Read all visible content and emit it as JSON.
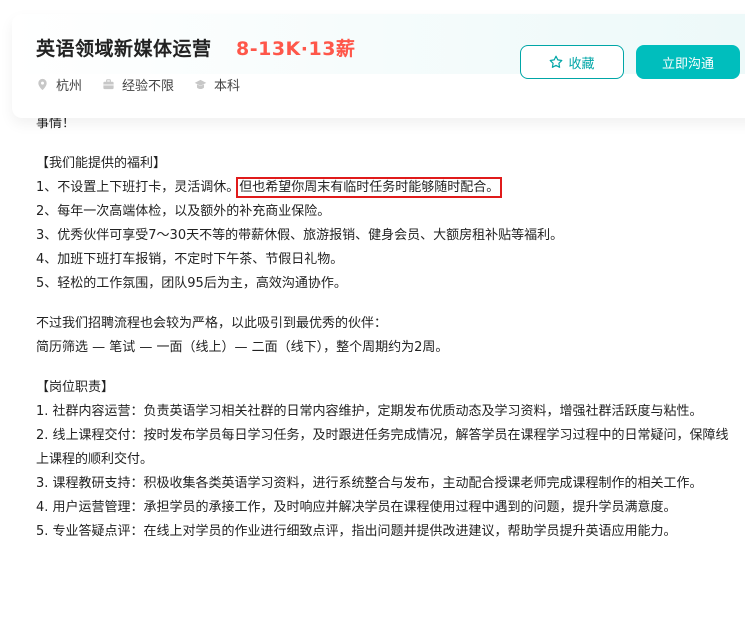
{
  "header": {
    "title": "英语领域新媒体运营",
    "salary": "8-13K·13薪",
    "location": "杭州",
    "experience": "经验不限",
    "education": "本科",
    "favorite_label": "收藏",
    "chat_label": "立即沟通",
    "accent_color": "#00bebd",
    "salary_color": "#fe574a"
  },
  "description": {
    "lead_tail": "事情！",
    "benefits_heading": "【我们能提供的福利】",
    "benefit_1_prefix": "1、不设置上下班打卡，灵活调休。",
    "benefit_1_highlight": "但也希望你周末有临时任务时能够随时配合。",
    "benefit_2": "2、每年一次高端体检，以及额外的补充商业保险。",
    "benefit_3": "3、优秀伙伴可享受7～30天不等的带薪休假、旅游报销、健身会员、大额房租补贴等福利。",
    "benefit_4": "4、加班下班打车报销，不定时下午茶、节假日礼物。",
    "benefit_5": "5、轻松的工作氛围，团队95后为主，高效沟通协作。",
    "process_intro": "不过我们招聘流程也会较为严格，以此吸引到最优秀的伙伴：",
    "process_steps": "简历筛选 — 笔试 — 一面（线上）— 二面（线下），整个周期约为2周。",
    "duties_heading": "【岗位职责】",
    "duty_1": "1. 社群内容运营：负责英语学习相关社群的日常内容维护，定期发布优质动态及学习资料，增强社群活跃度与粘性。",
    "duty_2": "2. 线上课程交付：按时发布学员每日学习任务，及时跟进任务完成情况，解答学员在课程学习过程中的日常疑问，保障线上课程的顺利交付。",
    "duty_3": "3. 课程教研支持：积极收集各类英语学习资料，进行系统整合与发布，主动配合授课老师完成课程制作的相关工作。",
    "duty_4": "4. 用户运营管理：承担学员的承接工作，及时响应并解决学员在课程使用过程中遇到的问题，提升学员满意度。",
    "duty_5": "5. 专业答疑点评：在线上对学员的作业进行细致点评，指出问题并提供改进建议，帮助学员提升英语应用能力。"
  }
}
